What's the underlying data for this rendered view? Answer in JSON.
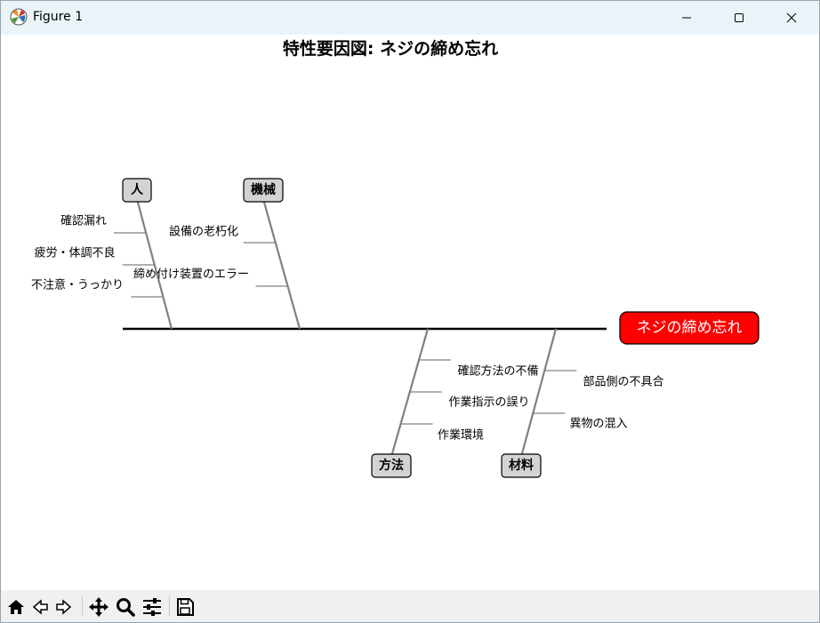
{
  "window": {
    "title": "Figure 1",
    "controls": [
      "minimize-icon",
      "maximize-icon",
      "close-icon"
    ]
  },
  "diagram": {
    "title": "特性要因図: ネジの締め忘れ",
    "effect": "ネジの締め忘れ",
    "effect_color": "#ff0000",
    "category_box_color": "#d3d3d3",
    "bone_color": "#808080",
    "categories": [
      {
        "name": "人",
        "causes": [
          "確認漏れ",
          "疲労・体調不良",
          "不注意・うっかり"
        ]
      },
      {
        "name": "機械",
        "causes": [
          "設備の老朽化",
          "締め付け装置のエラー"
        ]
      },
      {
        "name": "方法",
        "causes": [
          "確認方法の不備",
          "作業指示の誤り",
          "作業環境"
        ]
      },
      {
        "name": "材料",
        "causes": [
          "部品側の不具合",
          "異物の混入"
        ]
      }
    ]
  },
  "toolbar": {
    "tools": [
      "home-icon",
      "back-icon",
      "forward-icon",
      "pan-icon",
      "zoom-icon",
      "configure-subplots-icon",
      "save-icon"
    ]
  }
}
